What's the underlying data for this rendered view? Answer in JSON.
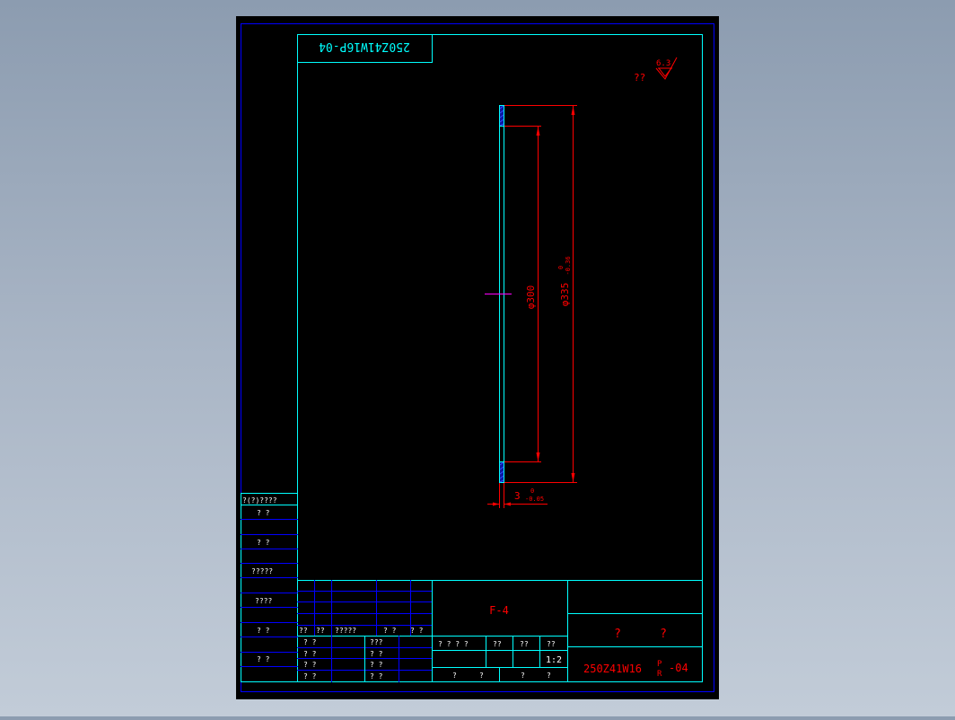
{
  "drawing": {
    "title_top": "250Z41W16P-04",
    "roughness_symbol_text": "??",
    "roughness_value": "6.3",
    "dim_inner": "φ300",
    "dim_outer": "φ335",
    "dim_outer_tol_upper": "0",
    "dim_outer_tol_lower": "-0.36",
    "dim_thickness": "3",
    "dim_thickness_tol_upper": "0",
    "dim_thickness_tol_lower": "-0.05"
  },
  "left_strip": {
    "header": "?(?)????",
    "rows": [
      "?   ?",
      "?   ?",
      "?????",
      "????",
      "?   ?",
      "?   ?"
    ]
  },
  "title_block": {
    "part_code": "F-4",
    "company_1": "?",
    "company_2": "?",
    "drawing_no": "250Z41W16",
    "drawing_no_sup": "P",
    "drawing_no_sub": "R",
    "drawing_no_suffix": "-04",
    "scale": "1:2",
    "rev_header": [
      "??",
      "??",
      "?????",
      "?  ?",
      "?  ?"
    ],
    "sign_rows": [
      [
        "?  ?",
        "???"
      ],
      [
        "?  ?",
        "?  ?"
      ],
      [
        "?  ?",
        "?  ?"
      ],
      [
        "?  ?",
        "?  ?"
      ]
    ],
    "mid_header": [
      "?  ?  ?  ?",
      "??",
      "??",
      "??"
    ],
    "mid_bottom": [
      "?",
      "?",
      "?",
      "?"
    ]
  },
  "colors": {
    "frame": "#0000ff",
    "border": "#00ffff",
    "dimension": "#ff0000",
    "centerline": "#ff00ff",
    "hatch": "#2040ff",
    "paper": "#000000"
  }
}
